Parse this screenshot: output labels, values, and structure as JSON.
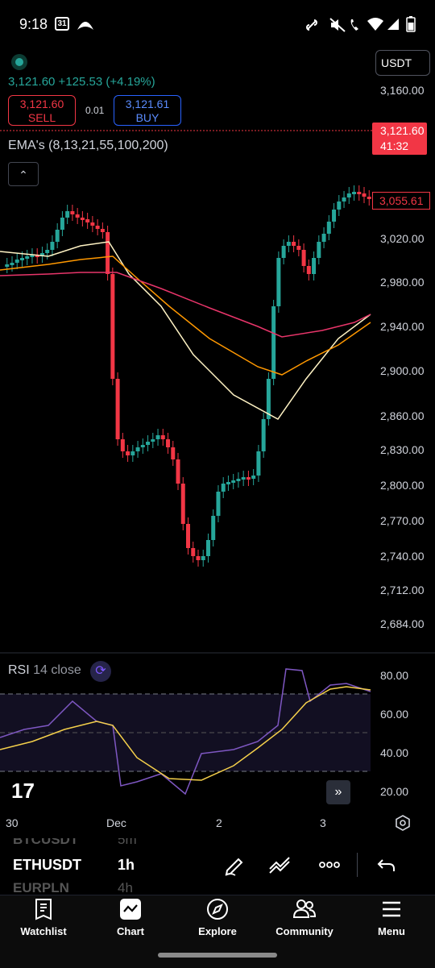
{
  "status_bar": {
    "time": "9:18",
    "calendar_day": "31"
  },
  "header": {
    "last_line": "3,121.60  +125.53 (+4.19%)",
    "sell_price": "3,121.60",
    "sell_label": "SELL",
    "buy_price": "3,121.61",
    "buy_label": "BUY",
    "spread": "0.01",
    "currency": "USDT",
    "ema_legend": "EMA's (8,13,21,55,100,200)"
  },
  "price_axis": {
    "labels": [
      "3,160.00",
      "3,020.00",
      "2,980.00",
      "2,940.00",
      "2,900.00",
      "2,860.00",
      "2,830.00",
      "2,800.00",
      "2,770.00",
      "2,740.00",
      "2,712.00",
      "2,684.00"
    ],
    "current_price": "3,121.60",
    "countdown": "41:32",
    "ema_price": "3,055.61"
  },
  "rsi": {
    "title": "RSI",
    "params": "14 close",
    "labels": [
      "80.00",
      "60.00",
      "40.00",
      "20.00"
    ]
  },
  "time_axis": {
    "labels": [
      "30",
      "Dec",
      "2",
      "3"
    ]
  },
  "logo_text": "17",
  "toolbar": {
    "symbol": "ETHUSDT",
    "timeframe": "1h",
    "prev_symbol": "BTCUSDT",
    "prev_tf": "5m",
    "next_symbol": "EURPLN",
    "next_tf": "4h"
  },
  "nav": {
    "watchlist": "Watchlist",
    "chart": "Chart",
    "explore": "Explore",
    "community": "Community",
    "menu": "Menu"
  },
  "colors": {
    "up": "#26a69a",
    "down": "#f23645",
    "ema_fast": "#fff3c4",
    "ema_mid": "#ff9800",
    "ema_slow": "#e8356a",
    "rsi_line": "#7e57c2",
    "rsi_ma": "#f5d04b"
  }
}
